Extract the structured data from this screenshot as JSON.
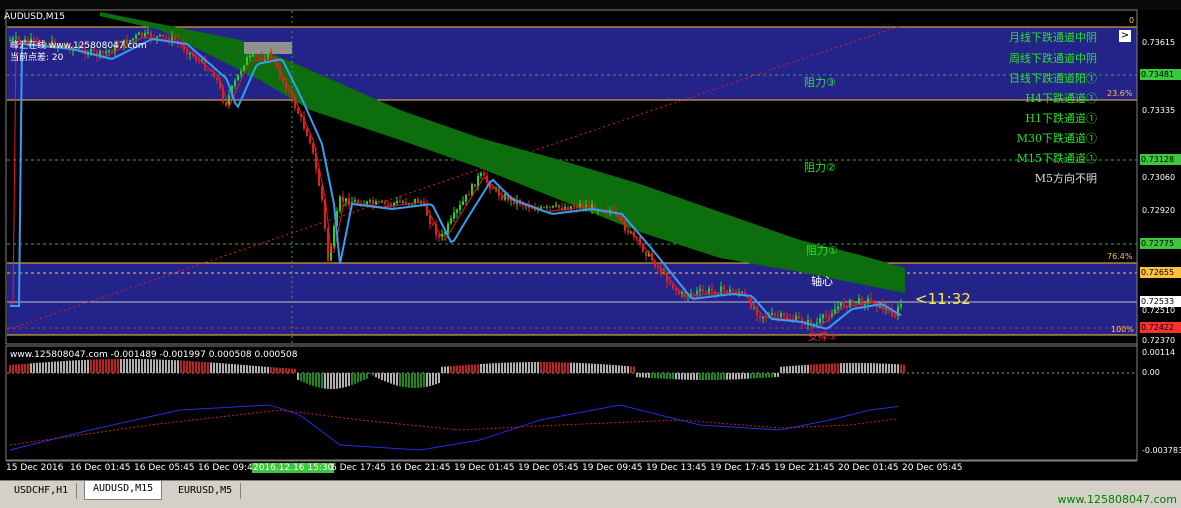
{
  "window": {
    "chart_title": "AUDUSD,M15",
    "shift_button": ">",
    "countdown": "<11:32",
    "ea_line1": "峰汇在线 www.125808047.com",
    "ea_line2": "当前点差:",
    "ea_spread": "20"
  },
  "channels": [
    "月线下跌通道中阴",
    "周线下跌通道中阴",
    "日线下跌通道阳①",
    "H4下跌通道①",
    "H1下跌通道①",
    "M30下跌通道①",
    "M15下跌通道①",
    "M5方向不明"
  ],
  "levels": {
    "resistance3": "阻力③",
    "resistance2": "阻力②",
    "resistance1": "阻力①",
    "pivot": "轴心",
    "support3": "支撑③"
  },
  "fib": {
    "zero": "0",
    "f236": "23.6%",
    "f764": "76.4%",
    "f100": "100%"
  },
  "price_axis": {
    "labels": [
      "0.73615",
      "0.73335",
      "0.73060",
      "0.72920",
      "0.72510",
      "0.72370"
    ],
    "tags": [
      {
        "value": "0.73481",
        "color": "#3cc83c"
      },
      {
        "value": "0.73128",
        "color": "#3cc83c"
      },
      {
        "value": "0.72775",
        "color": "#3cc83c"
      },
      {
        "value": "0.72655",
        "color": "#ffc040"
      },
      {
        "value": "0.72533",
        "color": "#ffffff"
      },
      {
        "value": "0.72422",
        "color": "#ff3030"
      }
    ]
  },
  "indicator": {
    "label": "www.125808047.com -0.001489 -0.001997 0.000508 0.000508",
    "axis_top": "0.00114",
    "axis_zero": "0.00",
    "axis_bottom": "-0.003783"
  },
  "time_axis": [
    "15 Dec 2016",
    "16 Dec 01:45",
    "16 Dec 05:45",
    "16 Dec 09:45",
    "2016.12.16 15:30",
    "6 Dec 17:45",
    "16 Dec 21:45",
    "19 Dec 01:45",
    "19 Dec 05:45",
    "19 Dec 09:45",
    "19 Dec 13:45",
    "19 Dec 17:45",
    "19 Dec 21:45",
    "20 Dec 01:45",
    "20 Dec 05:45"
  ],
  "tabs": [
    "USDCHF,H1",
    "AUDUSD,M15",
    "EURUSD,M5"
  ],
  "active_tab": "AUDUSD,M15",
  "footer_site": "www.125808047.com",
  "colors": {
    "zone": "#23238a",
    "cloud": "#0d6e0d",
    "bull": "#23d423",
    "bear": "#e02020",
    "ma_fast": "#e02020",
    "ma_slow": "#3a9cf0",
    "grid_green": "#33aa33",
    "fib": "#ffc040"
  }
}
